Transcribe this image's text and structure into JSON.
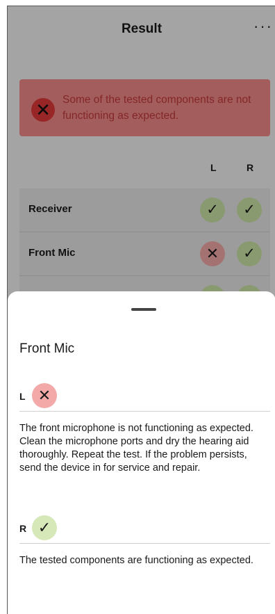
{
  "header": {
    "title": "Result",
    "more_icon": "more-horizontal-icon",
    "more_glyph": "···"
  },
  "alert": {
    "icon": "error-circle-icon",
    "glyph": "✕",
    "text": "Some of the tested components are not functioning as expected."
  },
  "columns": {
    "left": "L",
    "right": "R"
  },
  "rows": [
    {
      "label": "Receiver",
      "left": "pass",
      "right": "pass"
    },
    {
      "label": "Front Mic",
      "left": "fail",
      "right": "pass"
    },
    {
      "label": "",
      "left": "pass",
      "right": "pass"
    }
  ],
  "glyphs": {
    "pass": "✓",
    "fail": "✕"
  },
  "sheet": {
    "title": "Front Mic",
    "left": {
      "letter": "L",
      "status": "fail",
      "description": "The front microphone is not functioning as expected. Clean the microphone ports and dry the hearing aid thoroughly. Repeat the test. If the problem persists, send the device in for service and repair."
    },
    "right": {
      "letter": "R",
      "status": "pass",
      "description": "The tested components are functioning as expected."
    }
  },
  "colors": {
    "alert_bg": "#f28a8a",
    "alert_text": "#c2393a",
    "pass_bg": "#cbe3a6",
    "fail_bg": "#f4a9a9"
  }
}
